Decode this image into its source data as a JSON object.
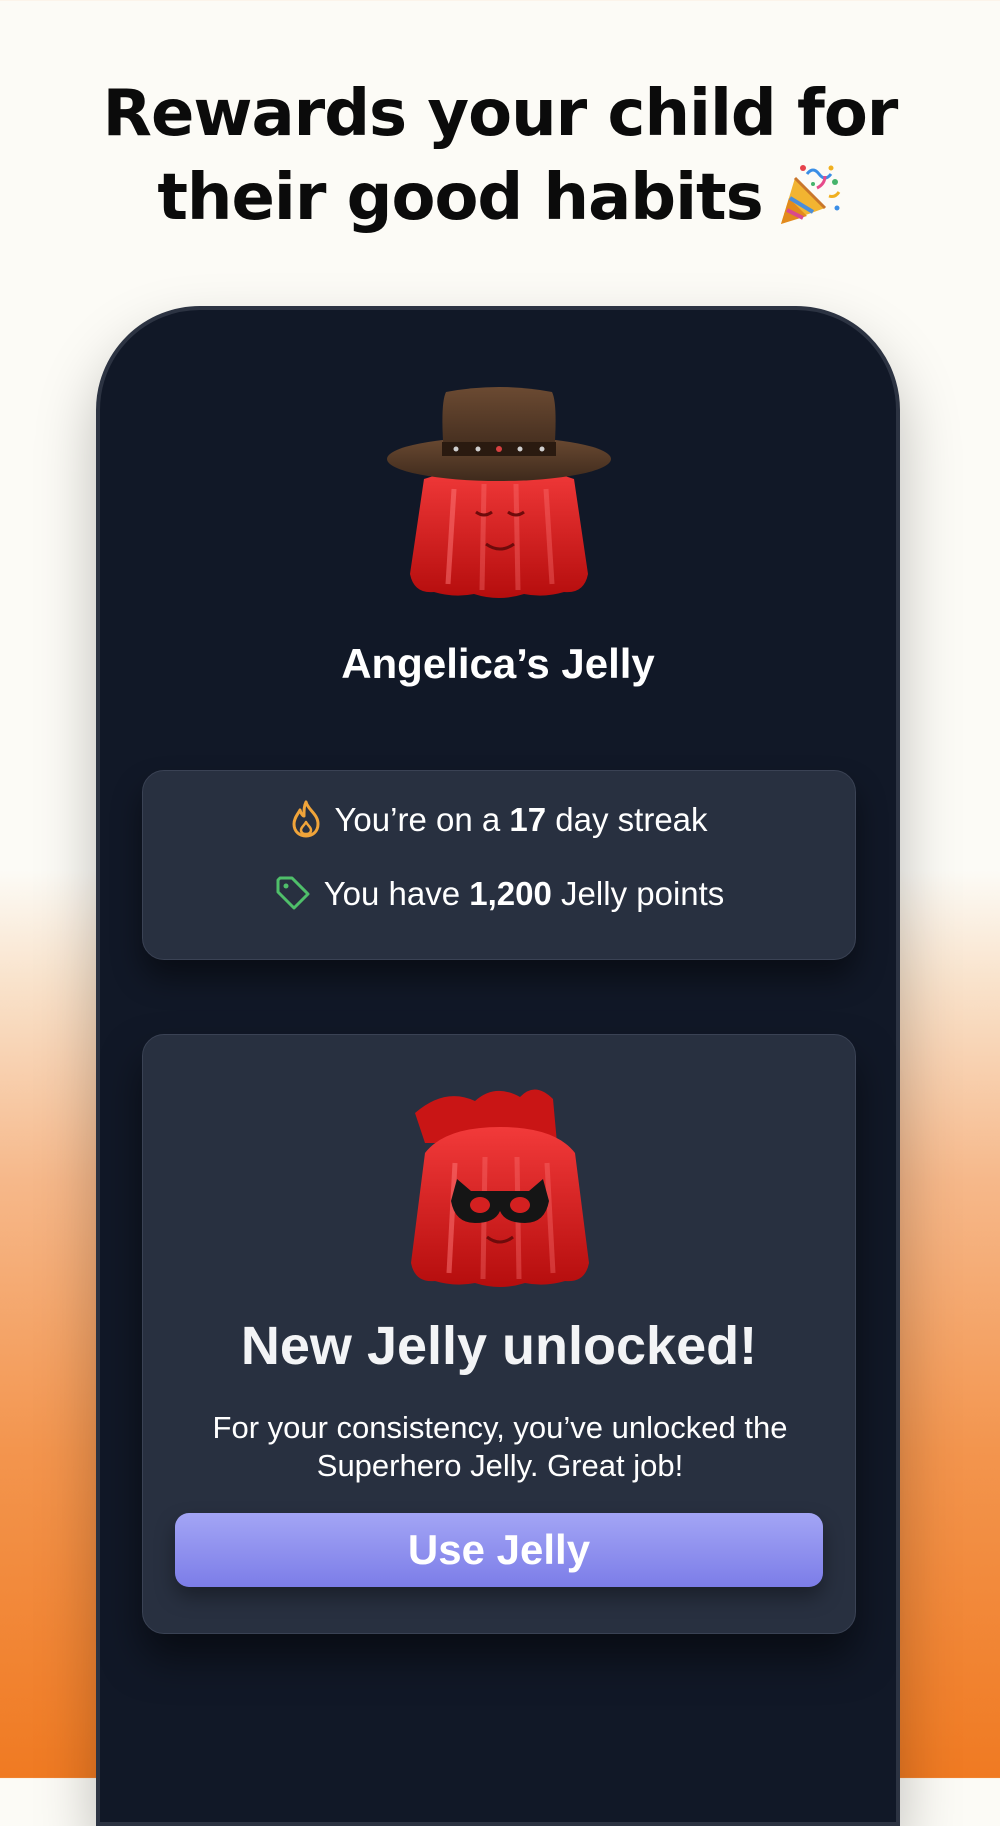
{
  "headline": {
    "line1": "Rewards your child for",
    "line2": "their good habits",
    "emoji_icon": "party-popper-icon"
  },
  "profile": {
    "jelly_name": "Angelica’s Jelly",
    "avatar": "cowboy-hat-jelly"
  },
  "stats": {
    "streak_prefix": "You’re on a",
    "streak_value": "17",
    "streak_suffix": "day streak",
    "streak_icon": "flame-icon",
    "points_prefix": "You have",
    "points_value": "1,200",
    "points_suffix": "Jelly points",
    "points_icon": "tag-icon"
  },
  "unlock": {
    "avatar": "superhero-jelly",
    "title": "New Jelly unlocked!",
    "description": "For your consistency, you’ve unlocked the Superhero Jelly. Great job!",
    "button_label": "Use Jelly"
  },
  "colors": {
    "phone_bg": "#111827",
    "card_bg": "#283040",
    "button": "#8f90ee",
    "flame": "#f0a43a",
    "tag": "#4fbf6a",
    "jelly_red": "#e01414"
  }
}
